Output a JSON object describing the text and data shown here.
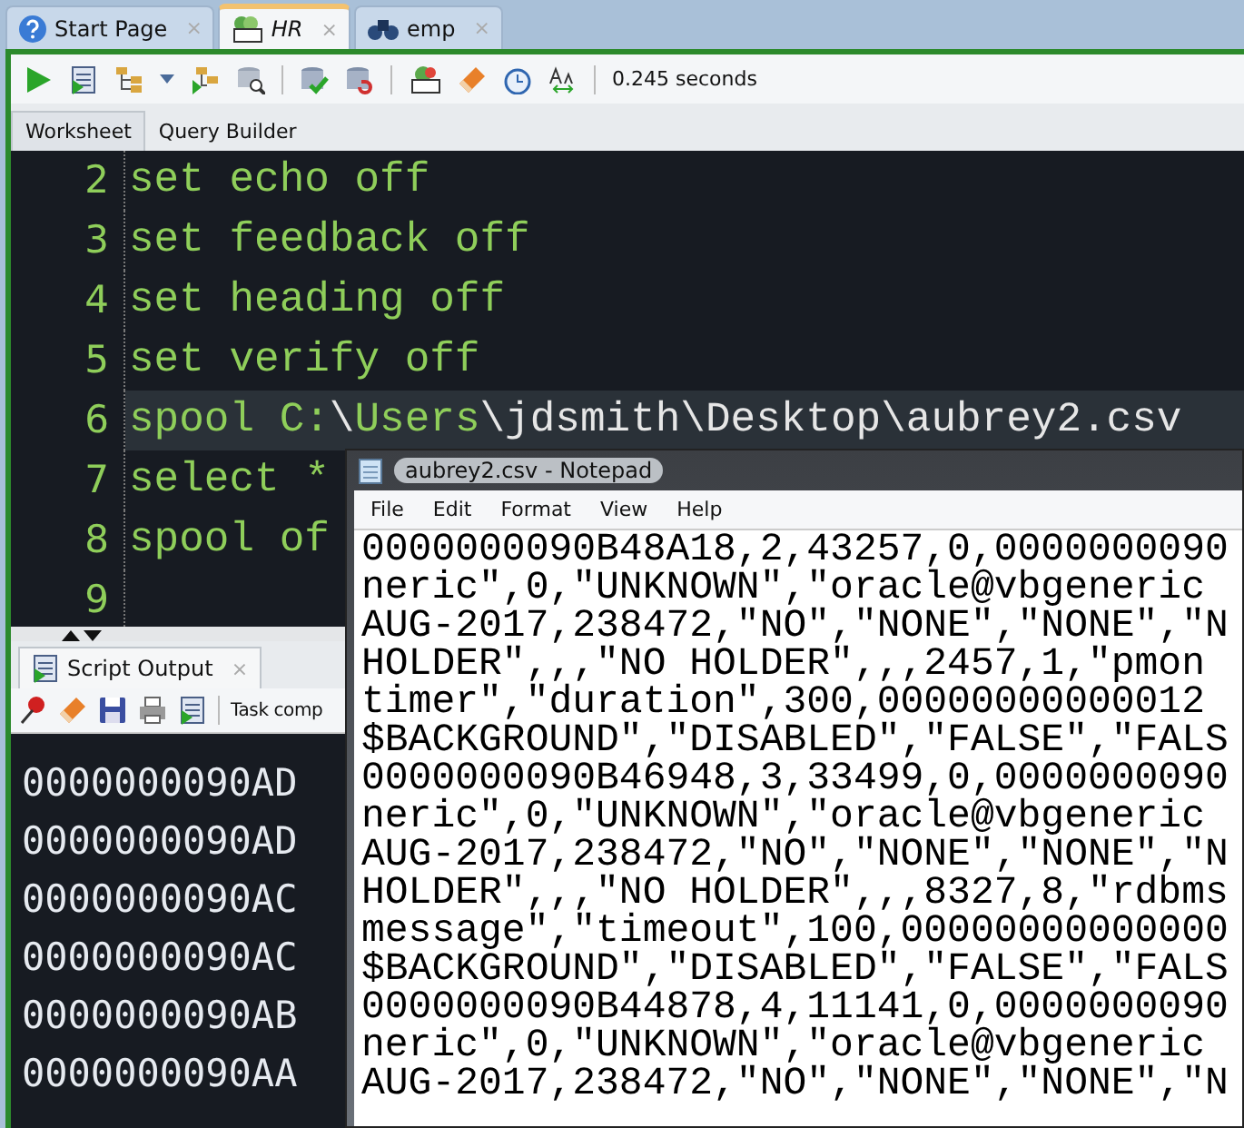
{
  "editor_tabs": [
    {
      "label": "Start Page",
      "close": "×",
      "selected": false
    },
    {
      "label": "HR",
      "close": "×",
      "selected": true
    },
    {
      "label": "emp",
      "close": "×",
      "selected": false
    }
  ],
  "toolbar": {
    "status": "0.245 seconds"
  },
  "worksheet_tabs": [
    {
      "label": "Worksheet",
      "selected": true
    },
    {
      "label": "Query Builder",
      "selected": false
    }
  ],
  "code_lines": [
    {
      "number": "2",
      "current": false,
      "segments": [
        {
          "text": "set echo off",
          "kind": "code"
        }
      ]
    },
    {
      "number": "3",
      "current": false,
      "segments": [
        {
          "text": "set feedback off",
          "kind": "code"
        }
      ]
    },
    {
      "number": "4",
      "current": false,
      "segments": [
        {
          "text": "set heading off",
          "kind": "code"
        }
      ]
    },
    {
      "number": "5",
      "current": false,
      "segments": [
        {
          "text": "set verify off",
          "kind": "code"
        }
      ]
    },
    {
      "number": "6",
      "current": true,
      "segments": [
        {
          "text": "spool C:",
          "kind": "code"
        },
        {
          "text": "\\",
          "kind": "path"
        },
        {
          "text": "Users",
          "kind": "code"
        },
        {
          "text": "\\jdsmith\\Desktop\\aubrey2.csv",
          "kind": "path"
        }
      ]
    },
    {
      "number": "7",
      "current": false,
      "segments": [
        {
          "text": "select *",
          "kind": "code"
        }
      ]
    },
    {
      "number": "8",
      "current": false,
      "segments": [
        {
          "text": "spool of",
          "kind": "code"
        }
      ]
    },
    {
      "number": "9",
      "current": false
    }
  ],
  "output_panel": {
    "title": "Script Output",
    "close": "×",
    "status": "Task comp",
    "lines": [
      "0000000090AD",
      "0000000090AD",
      "0000000090AC",
      "0000000090AC",
      "0000000090AB",
      "0000000090AA"
    ]
  },
  "notepad": {
    "title": "aubrey2.csv - Notepad",
    "menu": [
      "File",
      "Edit",
      "Format",
      "View",
      "Help"
    ],
    "lines": [
      "0000000090B48A18,2,43257,0,0000000090",
      "neric\",0,\"UNKNOWN\",\"oracle@vbgeneric",
      "AUG-2017,238472,\"NO\",\"NONE\",\"NONE\",\"N",
      "HOLDER\",,,\"NO HOLDER\",,,2457,1,\"pmon",
      "timer\",\"duration\",300,00000000000012",
      "$BACKGROUND\",\"DISABLED\",\"FALSE\",\"FALS",
      "0000000090B46948,3,33499,0,0000000090",
      "neric\",0,\"UNKNOWN\",\"oracle@vbgeneric",
      "AUG-2017,238472,\"NO\",\"NONE\",\"NONE\",\"N",
      "HOLDER\",,,\"NO HOLDER\",,,8327,8,\"rdbms",
      "message\",\"timeout\",100,00000000000000",
      "$BACKGROUND\",\"DISABLED\",\"FALSE\",\"FALS",
      "0000000090B44878,4,11141,0,0000000090",
      "neric\",0,\"UNKNOWN\",\"oracle@vbgeneric",
      "AUG-2017,238472,\"NO\",\"NONE\",\"NONE\",\"N"
    ]
  }
}
